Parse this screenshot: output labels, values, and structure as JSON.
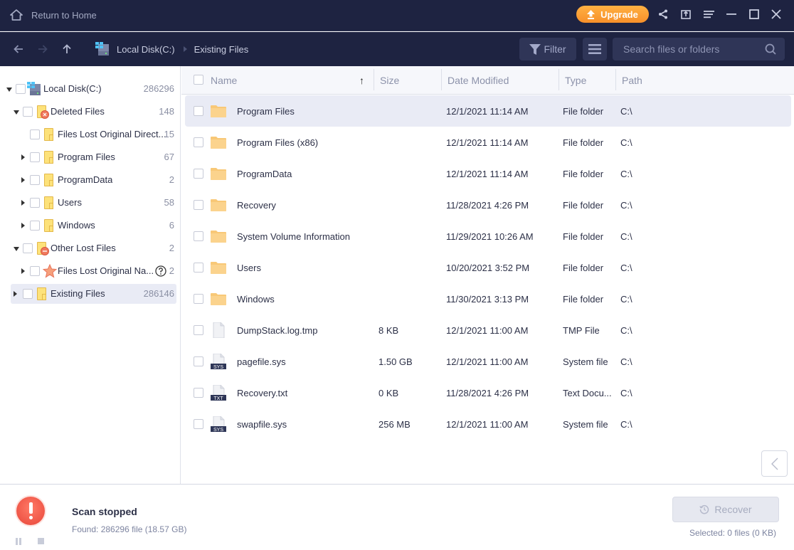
{
  "titlebar": {
    "home_label": "Return to Home",
    "upgrade_label": "Upgrade",
    "icons": [
      "share-icon",
      "export-icon",
      "menu-icon",
      "minimize-icon",
      "maximize-icon",
      "close-icon"
    ]
  },
  "navbar": {
    "breadcrumb": [
      "Local Disk(C:)",
      "Existing Files"
    ],
    "filter_label": "Filter",
    "search_placeholder": "Search files or folders"
  },
  "tree": [
    {
      "label": "Local Disk(C:)",
      "count": "286296",
      "icon": "drive-icon",
      "expand": "down",
      "level": 0
    },
    {
      "label": "Deleted Files",
      "count": "148",
      "icon": "deleted-folder-icon",
      "expand": "down",
      "level": 1
    },
    {
      "label": "Files Lost Original Direct...",
      "count": "15",
      "icon": "folder-icon",
      "expand": "none",
      "level": 2
    },
    {
      "label": "Program Files",
      "count": "67",
      "icon": "folder-icon",
      "expand": "right",
      "level": 2
    },
    {
      "label": "ProgramData",
      "count": "2",
      "icon": "folder-icon",
      "expand": "right",
      "level": 2
    },
    {
      "label": "Users",
      "count": "58",
      "icon": "folder-icon",
      "expand": "right",
      "level": 2
    },
    {
      "label": "Windows",
      "count": "6",
      "icon": "folder-icon",
      "expand": "right",
      "level": 2
    },
    {
      "label": "Other Lost Files",
      "count": "2",
      "icon": "lost-folder-icon",
      "expand": "down",
      "level": 1
    },
    {
      "label": "Files Lost Original Na...",
      "count": "2",
      "icon": "star-icon",
      "expand": "right",
      "level": 2,
      "help": true
    },
    {
      "label": "Existing Files",
      "count": "286146",
      "icon": "folder-icon",
      "expand": "right",
      "level": 1,
      "selected": true
    }
  ],
  "list": {
    "columns": [
      "Name",
      "Size",
      "Date Modified",
      "Type",
      "Path"
    ],
    "sort_indicator": "↑",
    "rows": [
      {
        "name": "Program Files",
        "size": "",
        "date": "12/1/2021 11:14 AM",
        "type": "File folder",
        "path": "C:\\",
        "icon": "folder",
        "selected": true
      },
      {
        "name": "Program Files (x86)",
        "size": "",
        "date": "12/1/2021 11:14 AM",
        "type": "File folder",
        "path": "C:\\",
        "icon": "folder"
      },
      {
        "name": "ProgramData",
        "size": "",
        "date": "12/1/2021 11:14 AM",
        "type": "File folder",
        "path": "C:\\",
        "icon": "folder"
      },
      {
        "name": "Recovery",
        "size": "",
        "date": "11/28/2021 4:26 PM",
        "type": "File folder",
        "path": "C:\\",
        "icon": "folder"
      },
      {
        "name": "System Volume Information",
        "size": "",
        "date": "11/29/2021 10:26 AM",
        "type": "File folder",
        "path": "C:\\",
        "icon": "folder"
      },
      {
        "name": "Users",
        "size": "",
        "date": "10/20/2021 3:52 PM",
        "type": "File folder",
        "path": "C:\\",
        "icon": "folder"
      },
      {
        "name": "Windows",
        "size": "",
        "date": "11/30/2021 3:13 PM",
        "type": "File folder",
        "path": "C:\\",
        "icon": "folder"
      },
      {
        "name": "DumpStack.log.tmp",
        "size": "8 KB",
        "date": "12/1/2021 11:00 AM",
        "type": "TMP File",
        "path": "C:\\",
        "icon": "file"
      },
      {
        "name": "pagefile.sys",
        "size": "1.50 GB",
        "date": "12/1/2021 11:00 AM",
        "type": "System file",
        "path": "C:\\",
        "icon": "file",
        "badge": "SYS"
      },
      {
        "name": "Recovery.txt",
        "size": "0 KB",
        "date": "11/28/2021 4:26 PM",
        "type": "Text Docu...",
        "path": "C:\\",
        "icon": "file",
        "badge": "TXT"
      },
      {
        "name": "swapfile.sys",
        "size": "256 MB",
        "date": "12/1/2021 11:00 AM",
        "type": "System file",
        "path": "C:\\",
        "icon": "file",
        "badge": "SYS"
      }
    ]
  },
  "footer": {
    "status_title": "Scan stopped",
    "found_text": "Found: 286296 file (18.57 GB)",
    "recover_label": "Recover",
    "selected_text": "Selected: 0 files (0 KB)"
  },
  "colors": {
    "header_bg": "#1e2341",
    "accent_orange": "#f7902a",
    "selection_bg": "#e9ebf5",
    "alert_red": "#e8463a"
  }
}
